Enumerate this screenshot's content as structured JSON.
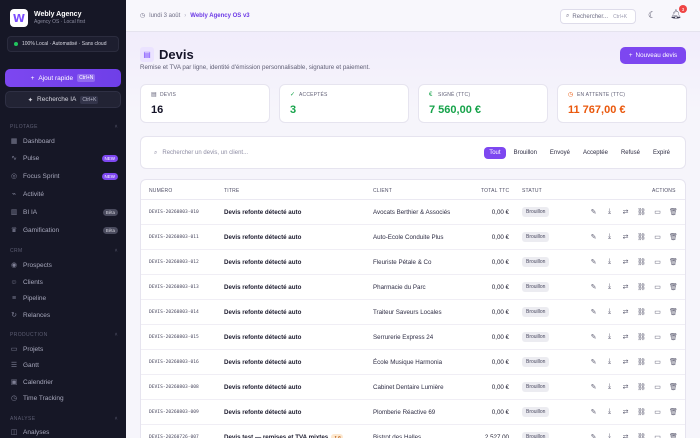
{
  "sidebar": {
    "brand_title": "Webly Agency",
    "brand_sub": "Agency OS · Local first",
    "local_status": "100% Local · Automatisé · Sans cloud",
    "quick_add_label": "Ajout rapide",
    "quick_add_kbd": "Ctrl+N",
    "ai_search_label": "Recherche IA",
    "ai_search_kbd": "Ctrl+K",
    "sections": [
      {
        "label": "PILOTAGE"
      },
      {
        "label": "CRM"
      },
      {
        "label": "PRODUCTION"
      },
      {
        "label": "ANALYSE"
      }
    ],
    "items": [
      {
        "label": "Dashboard",
        "icon": "grid-icon"
      },
      {
        "label": "Pulse",
        "icon": "pulse-icon",
        "badge": "NEW"
      },
      {
        "label": "Focus Sprint",
        "icon": "focus-icon",
        "badge": "NEW"
      },
      {
        "label": "Activité",
        "icon": "activity-icon"
      },
      {
        "label": "BI IA",
        "icon": "chart-icon",
        "badge": "Bêta"
      },
      {
        "label": "Gamification",
        "icon": "trophy-icon",
        "badge": "Bêta"
      },
      {
        "label": "Prospects",
        "icon": "target-icon"
      },
      {
        "label": "Clients",
        "icon": "users-icon"
      },
      {
        "label": "Pipeline",
        "icon": "pipeline-icon"
      },
      {
        "label": "Relances",
        "icon": "refresh-icon"
      },
      {
        "label": "Projets",
        "icon": "folder-icon"
      },
      {
        "label": "Gantt",
        "icon": "gantt-icon"
      },
      {
        "label": "Calendrier",
        "icon": "calendar-icon"
      },
      {
        "label": "Time Tracking",
        "icon": "clock-icon"
      },
      {
        "label": "Analyses",
        "icon": "analysis-icon"
      }
    ]
  },
  "topbar": {
    "date": "lundi 3 août",
    "agency": "Webly Agency OS v3",
    "search_label": "Rechercher...",
    "search_kbd": "Ctrl+K",
    "notif_count": "3"
  },
  "header": {
    "title": "Devis",
    "subtitle": "Remise et TVA par ligne, identité d'émission personnalisable, signature et paiement.",
    "new_button": "Nouveau devis"
  },
  "stats": [
    {
      "label": "DEVIS",
      "value": "16",
      "color": "#151428"
    },
    {
      "label": "ACCEPTÉS",
      "value": "3",
      "color": "#16a34a"
    },
    {
      "label": "SIGNÉ (TTC)",
      "value": "7 560,00 €",
      "color": "#16a34a"
    },
    {
      "label": "EN ATTENTE (TTC)",
      "value": "11 767,00 €",
      "color": "#ea580c"
    }
  ],
  "filters": {
    "search_placeholder": "Rechercher un devis, un client...",
    "tabs": [
      "Tout",
      "Brouillon",
      "Envoyé",
      "Acceptée",
      "Refusé",
      "Expiré"
    ],
    "active_tab": "Tout"
  },
  "table": {
    "columns": [
      "NUMÉRO",
      "TITRE",
      "CLIENT",
      "TOTAL TTC",
      "STATUT",
      "ACTIONS"
    ],
    "rows": [
      {
        "num": "DEVIS-20260803-010",
        "title": "Devis refonte détecté auto",
        "client": "Avocats Berthier & Associés",
        "total": "0,00 €",
        "status": "Brouillon"
      },
      {
        "num": "DEVIS-20260803-011",
        "title": "Devis refonte détecté auto",
        "client": "Auto-Ecole Conduite Plus",
        "total": "0,00 €",
        "status": "Brouillon"
      },
      {
        "num": "DEVIS-20260803-012",
        "title": "Devis refonte détecté auto",
        "client": "Fleuriste Pétale & Co",
        "total": "0,00 €",
        "status": "Brouillon"
      },
      {
        "num": "DEVIS-20260803-013",
        "title": "Devis refonte détecté auto",
        "client": "Pharmacie du Parc",
        "total": "0,00 €",
        "status": "Brouillon"
      },
      {
        "num": "DEVIS-20260803-014",
        "title": "Devis refonte détecté auto",
        "client": "Traiteur Saveurs Locales",
        "total": "0,00 €",
        "status": "Brouillon"
      },
      {
        "num": "DEVIS-20260803-015",
        "title": "Devis refonte détecté auto",
        "client": "Serrurerie Express 24",
        "total": "0,00 €",
        "status": "Brouillon"
      },
      {
        "num": "DEVIS-20260803-016",
        "title": "Devis refonte détecté auto",
        "client": "École Musique Harmonia",
        "total": "0,00 €",
        "status": "Brouillon"
      },
      {
        "num": "DEVIS-20260803-008",
        "title": "Devis refonte détecté auto",
        "client": "Cabinet Dentaire Lumière",
        "total": "0,00 €",
        "status": "Brouillon"
      },
      {
        "num": "DEVIS-20260803-009",
        "title": "Devis refonte détecté auto",
        "client": "Plomberie Réactive 69",
        "total": "0,00 €",
        "status": "Brouillon"
      },
      {
        "num": "DEVIS-20260726-007",
        "title": "Devis test — remises et TVA mixtes",
        "tag": "1.0",
        "client": "Bistrot des Halles",
        "total": "2 527,00 €",
        "status": "Brouillon"
      }
    ]
  }
}
